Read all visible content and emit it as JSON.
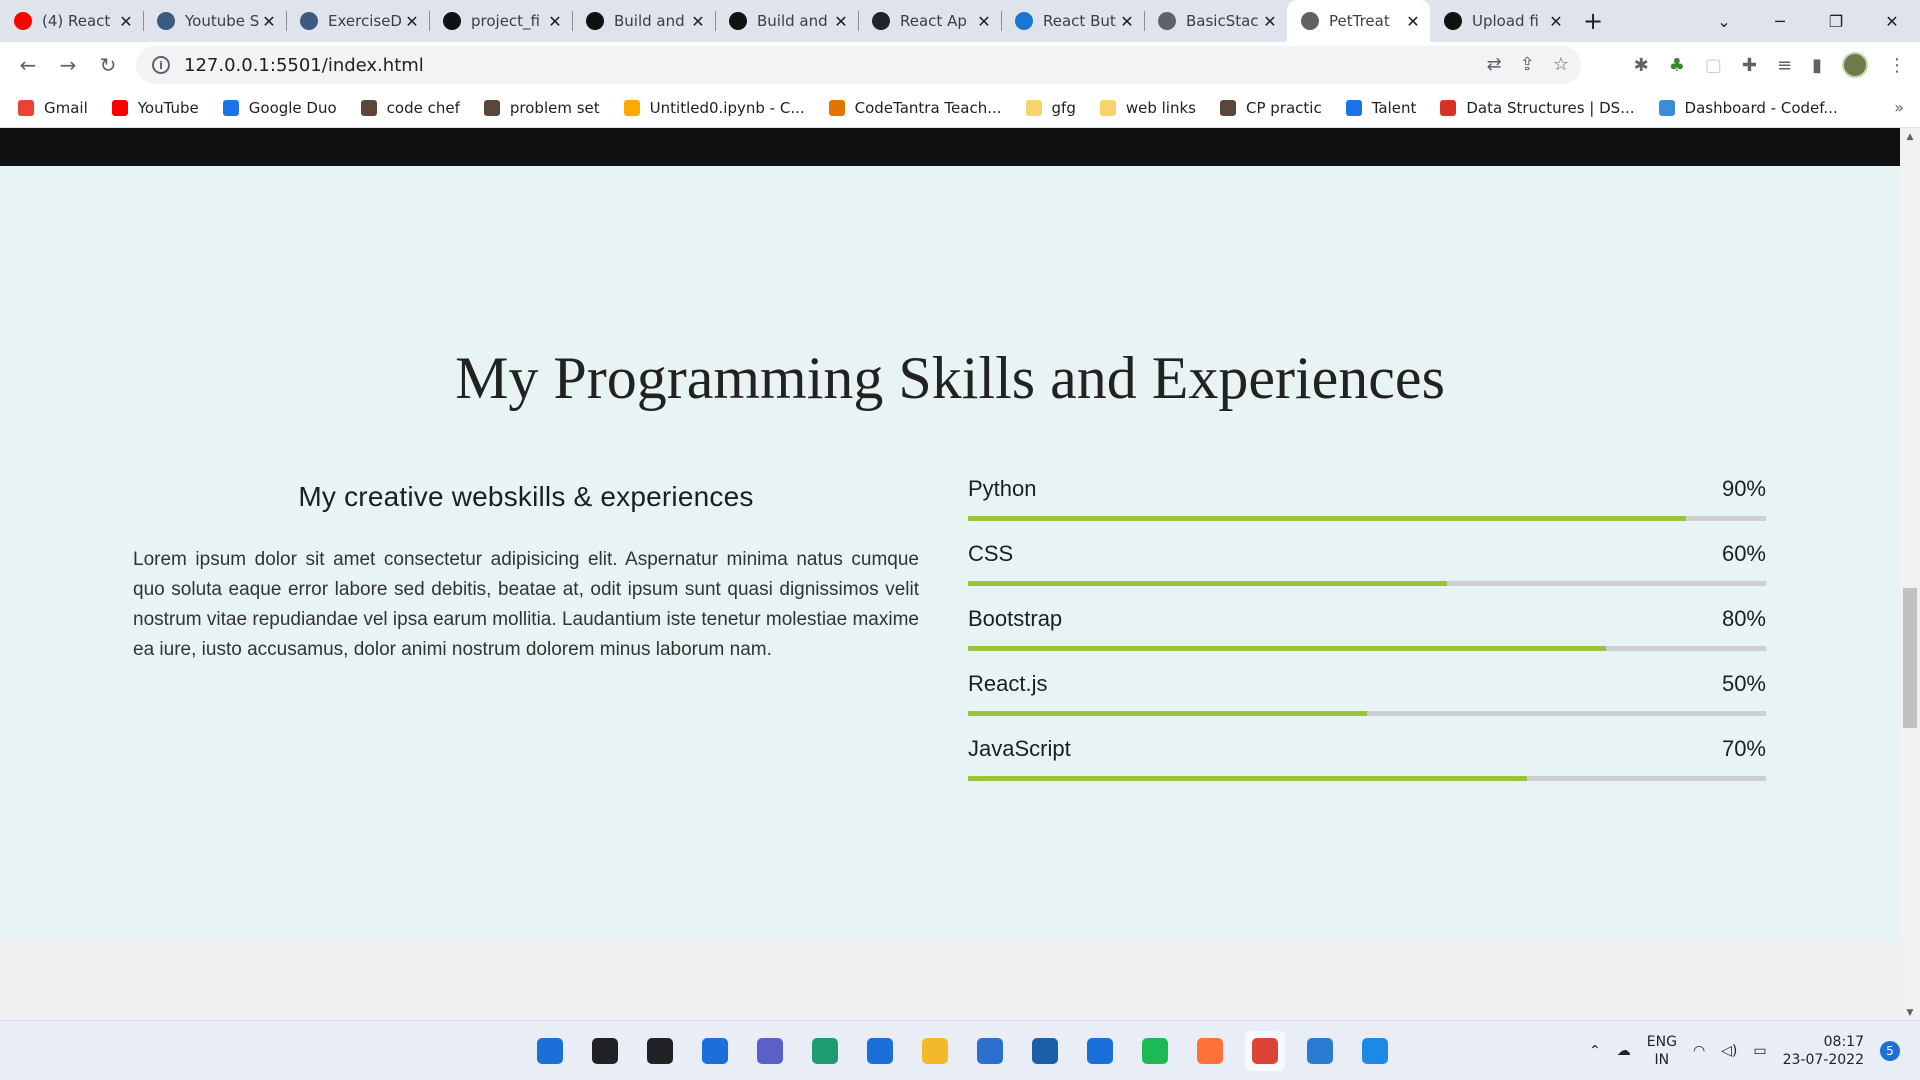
{
  "browser": {
    "tabs": [
      {
        "label": "(4) React",
        "icon": "youtube-icon",
        "color": "#ff0000"
      },
      {
        "label": "Youtube S",
        "icon": "octocat-icon",
        "color": "#3d5a80"
      },
      {
        "label": "ExerciseD",
        "icon": "octocat-icon",
        "color": "#3d5a80"
      },
      {
        "label": "project_fi",
        "icon": "github-icon",
        "color": "#111111"
      },
      {
        "label": "Build and",
        "icon": "github-icon",
        "color": "#111111"
      },
      {
        "label": "Build and",
        "icon": "github-icon",
        "color": "#111111"
      },
      {
        "label": "React Ap",
        "icon": "react-icon",
        "color": "#20232a"
      },
      {
        "label": "React But",
        "icon": "mui-icon",
        "color": "#1976d2"
      },
      {
        "label": "BasicStac",
        "icon": "page-icon",
        "color": "#5f6368"
      },
      {
        "label": "PetTreat",
        "icon": "globe-icon",
        "color": "#5f6368",
        "active": true
      },
      {
        "label": "Upload fi",
        "icon": "github-icon",
        "color": "#111111"
      }
    ],
    "url": "127.0.0.1:5501/index.html",
    "bookmarks": [
      {
        "label": "Gmail",
        "icon": "gmail-icon",
        "color": "#ea4335"
      },
      {
        "label": "YouTube",
        "icon": "youtube-icon",
        "color": "#ff0000"
      },
      {
        "label": "Google Duo",
        "icon": "duo-icon",
        "color": "#1a73e8"
      },
      {
        "label": "code chef",
        "icon": "codechef-icon",
        "color": "#5b4638"
      },
      {
        "label": "problem set",
        "icon": "codechef-icon",
        "color": "#5b4638"
      },
      {
        "label": "Untitled0.ipynb - C...",
        "icon": "colab-icon",
        "color": "#f9ab00"
      },
      {
        "label": "CodeTantra Teach...",
        "icon": "codetantra-icon",
        "color": "#e37400"
      },
      {
        "label": "gfg",
        "icon": "folder-icon",
        "color": "#f6d36b"
      },
      {
        "label": "web links",
        "icon": "folder-icon",
        "color": "#f6d36b"
      },
      {
        "label": "CP practic",
        "icon": "codechef-icon",
        "color": "#5b4638"
      },
      {
        "label": "Talent",
        "icon": "talent-icon",
        "color": "#1a73e8"
      },
      {
        "label": "Data Structures | DS...",
        "icon": "tutorial-icon",
        "color": "#d93025"
      },
      {
        "label": "Dashboard - Codef...",
        "icon": "chart-icon",
        "color": "#3c8dd8"
      }
    ]
  },
  "page": {
    "section_title": "My Programming Skills and Experiences",
    "subtitle": "My creative webskills & experiences",
    "paragraph": "Lorem ipsum dolor sit amet consectetur adipisicing elit. Aspernatur minima natus cumque quo soluta eaque error labore sed debitis, beatae at, odit ipsum sunt quasi dignissimos velit nostrum vitae repudiandae vel ipsa earum mollitia. Laudantium iste tenetur molestiae maxime ea iure, iusto accusamus, dolor animi nostrum dolorem minus laborum nam.",
    "skills": [
      {
        "name": "Python",
        "percent_label": "90%",
        "level": 0.9
      },
      {
        "name": "CSS",
        "percent_label": "60%",
        "level": 0.6
      },
      {
        "name": "Bootstrap",
        "percent_label": "80%",
        "level": 0.8
      },
      {
        "name": "React.js",
        "percent_label": "50%",
        "level": 0.5
      },
      {
        "name": "JavaScript",
        "percent_label": "70%",
        "level": 0.7
      }
    ],
    "accent_color": "#9ac53a"
  },
  "taskbar": {
    "apps": [
      {
        "icon": "windows-start-icon",
        "color": "#1b6fd8"
      },
      {
        "icon": "search-icon",
        "color": "#202124"
      },
      {
        "icon": "task-view-icon",
        "color": "#202124"
      },
      {
        "icon": "widgets-icon",
        "color": "#1b6fd8"
      },
      {
        "icon": "teams-chat-icon",
        "color": "#5b5fc7"
      },
      {
        "icon": "edge-icon",
        "color": "#1e9b6f"
      },
      {
        "icon": "mail-icon",
        "color": "#1b6fd8"
      },
      {
        "icon": "file-explorer-icon",
        "color": "#f3b92b"
      },
      {
        "icon": "store-icon",
        "color": "#2d6fcf"
      },
      {
        "icon": "dell-icon",
        "color": "#1a5fa8"
      },
      {
        "icon": "media-player-icon",
        "color": "#1b6fd8"
      },
      {
        "icon": "spotify-icon",
        "color": "#1db954"
      },
      {
        "icon": "firefox-icon",
        "color": "#ff7139"
      },
      {
        "icon": "chrome-icon",
        "color": "#db4437",
        "active": true
      },
      {
        "icon": "photos-icon",
        "color": "#2a7bd1"
      },
      {
        "icon": "vscode-icon",
        "color": "#1e88e5"
      }
    ],
    "language_line1": "ENG",
    "language_line2": "IN",
    "time": "08:17",
    "date": "23-07-2022",
    "notification_count": "5"
  }
}
